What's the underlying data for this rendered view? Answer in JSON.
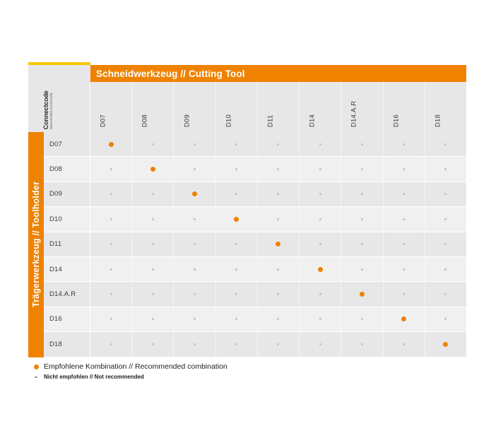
{
  "logo": {
    "brand": "Connectcode",
    "url": "www.simtek.com/ccode"
  },
  "header": {
    "column_axis_title": "Schneidwerkzeug // Cutting Tool",
    "row_axis_title": "Trägerwerkzeug // Toolholder"
  },
  "chart_data": {
    "type": "heatmap",
    "title": "Schneidwerkzeug // Cutting Tool",
    "xlabel": "Schneidwerkzeug // Cutting Tool",
    "ylabel": "Trägerwerkzeug // Toolholder",
    "columns": [
      "D07",
      "D08",
      "D09",
      "D10",
      "D11",
      "D14",
      "D14.A.R",
      "D16",
      "D18"
    ],
    "rows": [
      "D07",
      "D08",
      "D09",
      "D10",
      "D11",
      "D14",
      "D14.A.R",
      "D16",
      "D18"
    ],
    "cell_states": [
      [
        "dot",
        "dash",
        "dash",
        "dash",
        "dash",
        "dash",
        "dash",
        "dash",
        "dash"
      ],
      [
        "dash",
        "dot",
        "dash",
        "dash",
        "dash",
        "dash",
        "dash",
        "dash",
        "dash"
      ],
      [
        "dash",
        "dash",
        "dot",
        "dash",
        "dash",
        "dash",
        "dash",
        "dash",
        "dash"
      ],
      [
        "dash",
        "dash",
        "dash",
        "dot",
        "dash",
        "dash",
        "dash",
        "dash",
        "dash"
      ],
      [
        "dash",
        "dash",
        "dash",
        "dash",
        "dot",
        "dash",
        "dash",
        "dash",
        "dash"
      ],
      [
        "dash",
        "dash",
        "dash",
        "dash",
        "dash",
        "dot",
        "dash",
        "dash",
        "dash"
      ],
      [
        "dash",
        "dash",
        "dash",
        "dash",
        "dash",
        "dash",
        "dot",
        "dash",
        "dash"
      ],
      [
        "dash",
        "dash",
        "dash",
        "dash",
        "dash",
        "dash",
        "dash",
        "dot",
        "dash"
      ],
      [
        "dash",
        "dash",
        "dash",
        "dash",
        "dash",
        "dash",
        "dash",
        "dash",
        "dot"
      ]
    ],
    "legend_position": "below",
    "grid": true
  },
  "legend": {
    "recommended": "Empfohlene Kombination // Recommended combination",
    "not_recommended": "Nicht empfohlen // Not recommended"
  },
  "colors": {
    "accent_orange": "#EF8200",
    "accent_yellow": "#F7C600",
    "band_dark": "#E7E7E7",
    "band_light": "#F0F0F0",
    "dash_gray": "#C9C9C9"
  }
}
